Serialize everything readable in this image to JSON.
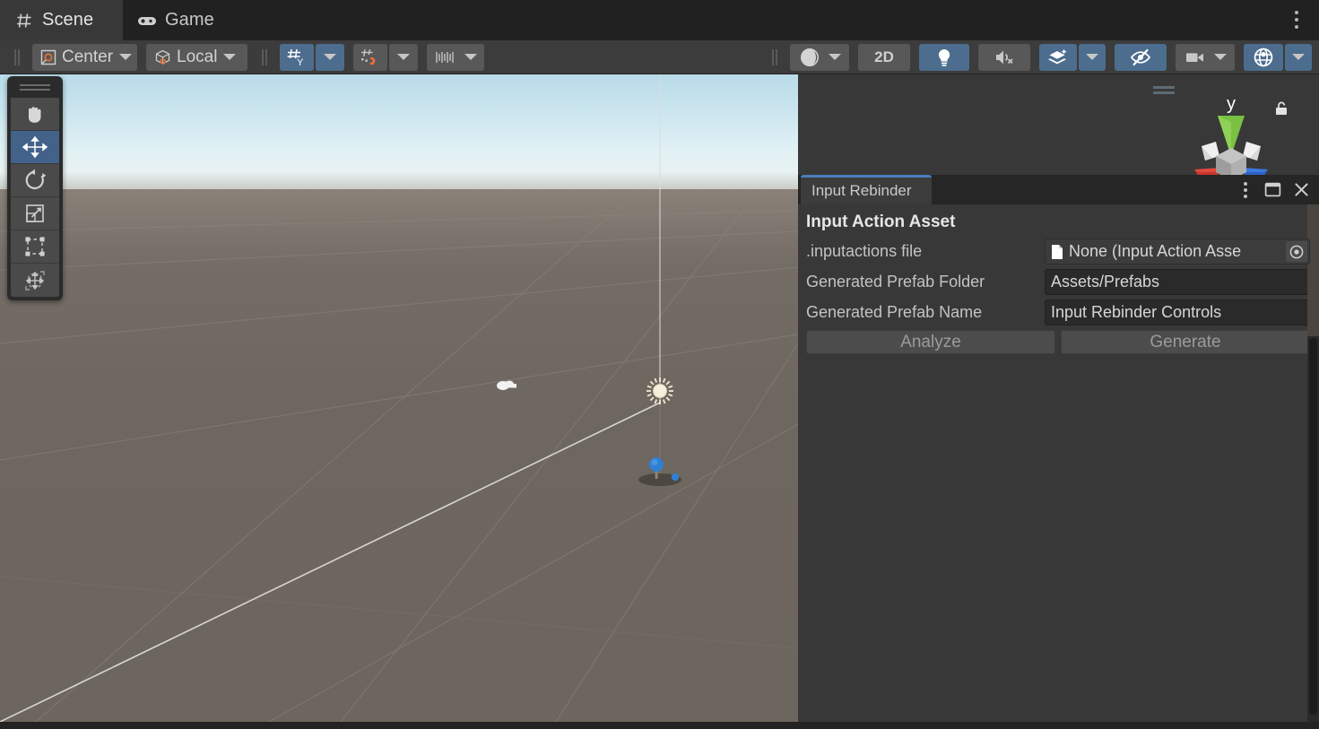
{
  "window": {
    "tabs": [
      {
        "label": "Scene",
        "icon": "grid-hash-icon",
        "active": true
      },
      {
        "label": "Game",
        "icon": "gamepad-icon",
        "active": false
      }
    ],
    "menu_icon": "kebab-menu-icon"
  },
  "toolbar": {
    "pivot_mode": {
      "label": "Center",
      "icon": "pivot-center-icon"
    },
    "handle_space": {
      "label": "Local",
      "icon": "cube-local-icon"
    },
    "grid_axis": {
      "label": "Y",
      "icon": "grid-axis-y-icon",
      "active": true
    },
    "grid_snap": {
      "icon": "grid-snap-magnet-icon",
      "active": false
    },
    "snap_increment": {
      "icon": "snap-increment-icon",
      "active": false
    },
    "shading_mode": {
      "icon": "shaded-sphere-icon",
      "active": false
    },
    "view_2d": {
      "label": "2D",
      "active": false
    },
    "scene_lighting": {
      "icon": "lightbulb-icon",
      "active": true
    },
    "scene_audio": {
      "icon": "audio-muted-icon",
      "active": false
    },
    "effects": {
      "icon": "effects-layers-icon",
      "active": true
    },
    "hidden_objects": {
      "icon": "eye-off-icon",
      "active": true
    },
    "camera_settings": {
      "icon": "camera-icon",
      "active": false
    },
    "gizmos": {
      "icon": "gizmos-globe-icon",
      "active": true
    }
  },
  "tools_palette": {
    "items": [
      {
        "name": "hand-tool",
        "icon": "hand-icon",
        "selected": false
      },
      {
        "name": "move-tool",
        "icon": "move-arrows-icon",
        "selected": true
      },
      {
        "name": "rotate-tool",
        "icon": "rotate-icon",
        "selected": false
      },
      {
        "name": "scale-tool",
        "icon": "scale-icon",
        "selected": false
      },
      {
        "name": "rect-tool",
        "icon": "rect-transform-icon",
        "selected": false
      },
      {
        "name": "transform-tool",
        "icon": "move-rotate-scale-icon",
        "selected": false
      }
    ]
  },
  "scene": {
    "gizmo_axis_label": "y",
    "objects": [
      {
        "name": "camera-gizmo",
        "icon": "camera-gizmo-icon"
      },
      {
        "name": "directional-light-gizmo",
        "icon": "sun-icon"
      },
      {
        "name": "selected-object",
        "icon": "blue-sphere-handle"
      }
    ],
    "overlay_handle": "drag-handle-icon",
    "lock_icon": "lock-open-icon"
  },
  "input_rebinder": {
    "tab_label": "Input Rebinder",
    "window_buttons": {
      "kebab": "kebab-menu-icon",
      "maximize": "maximize-icon",
      "close": "close-icon"
    },
    "section_title": "Input Action Asset",
    "fields": [
      {
        "label": ".inputactions file",
        "value": "None (Input Action Asse",
        "type": "object-field",
        "icon": "document-icon",
        "picker": "object-picker-icon"
      },
      {
        "label": "Generated Prefab Folder",
        "value": "Assets/Prefabs",
        "type": "text-field"
      },
      {
        "label": "Generated Prefab Name",
        "value": "Input Rebinder Controls",
        "type": "text-field"
      }
    ],
    "buttons": [
      {
        "label": "Analyze",
        "name": "analyze-button",
        "disabled": true
      },
      {
        "label": "Generate",
        "name": "generate-button",
        "disabled": true
      }
    ]
  },
  "colors": {
    "accent_blue": "#4a7dbf",
    "toolbar_active": "#4c6d8e",
    "panel_bg": "#383838",
    "tabbar_bg": "#212121",
    "field_bg": "#2a2a2a",
    "ground": "#6e675f",
    "sky_top": "#b8dbe8"
  }
}
